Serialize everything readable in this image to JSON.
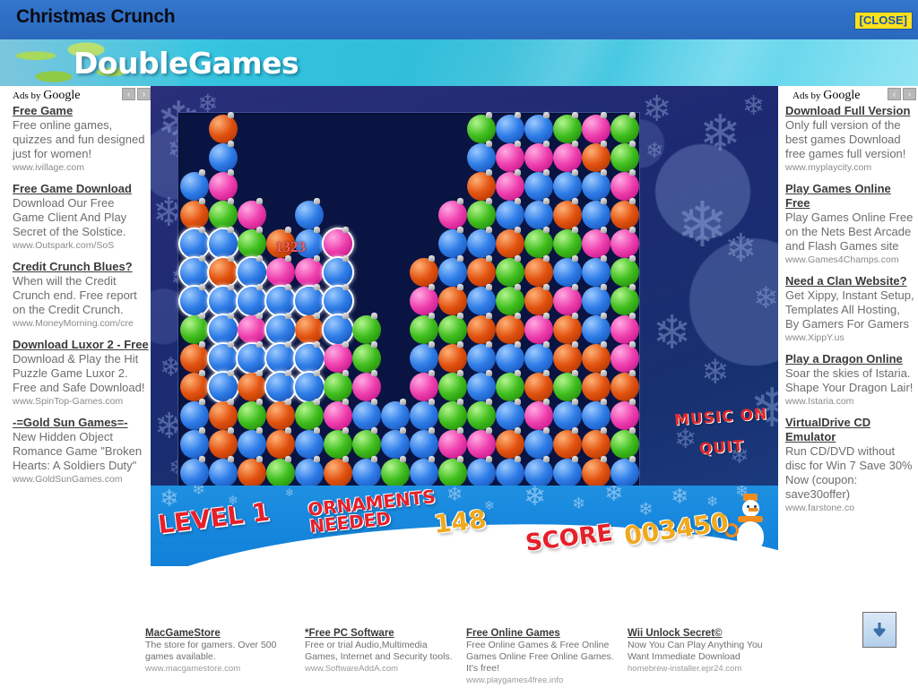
{
  "window": {
    "title": "Christmas Crunch",
    "close_label": "[CLOSE]"
  },
  "banner": {
    "logo": "DoubleGames"
  },
  "ads_left": {
    "header": "Ads by ",
    "brand": "Google",
    "prev": "‹",
    "next": "›",
    "items": [
      {
        "title": "Free Game",
        "desc": "Free online games, quizzes and fun designed just for women!",
        "url": "www.ivillage.com"
      },
      {
        "title": "Free Game Download",
        "desc": "Download Our Free Game Client And Play Secret of the Solstice.",
        "url": "www.Outspark.com/SoS"
      },
      {
        "title": "Credit Crunch Blues?",
        "desc": "When will the Credit Crunch end. Free report on the Credit Crunch.",
        "url": "www.MoneyMorning.com/cre"
      },
      {
        "title": "Download Luxor 2 - Free",
        "desc": "Download & Play the Hit Puzzle Game Luxor 2. Free and Safe Download!",
        "url": "www.SpinTop-Games.com"
      },
      {
        "title": "-=Gold Sun Games=-",
        "desc": "New Hidden Object Romance Game \"Broken Hearts: A Soldiers Duty\"",
        "url": "www.GoldSunGames.com"
      }
    ]
  },
  "ads_right": {
    "header": "Ads by ",
    "brand": "Google",
    "prev": "‹",
    "next": "›",
    "items": [
      {
        "title": "Download Full Version",
        "desc": "Only full version of the best games Download free games full version!",
        "url": "www.myplaycity.com"
      },
      {
        "title": "Play Games Online Free",
        "desc": "Play Games Online Free on the Nets Best Arcade and Flash Games site",
        "url": "www.Games4Champs.com"
      },
      {
        "title": "Need a Clan Website?",
        "desc": "Get Xippy, Instant Setup, Templates All Hosting, By Gamers For Gamers",
        "url": "www.XippY.us"
      },
      {
        "title": "Play a Dragon Online",
        "desc": "Soar the skies of Istaria. Shape Your Dragon Lair!",
        "url": "www.Istaria.com"
      },
      {
        "title": "VirtualDrive CD Emulator",
        "desc": "Run CD/DVD without disc for Win 7 Save 30% Now (coupon: save30offer)",
        "url": "www.farstone.co"
      }
    ]
  },
  "ads_footer": [
    {
      "title": "MacGameStore",
      "desc": "The store for gamers. Over 500 games available.",
      "url": "www.macgamestore.com"
    },
    {
      "title": "*Free PC Software",
      "desc": "Free or trial Audio,Multimedia Games, Internet and Security tools.",
      "url": "www.SoftwareAddA.com"
    },
    {
      "title": "Free Online Games",
      "desc": "Free Online Games & Free Online Games Online Free Online Games. It's free!",
      "url": "www.playgames4free.info"
    },
    {
      "title": "Wii Unlock Secret©",
      "desc": "Now You Can Play Anything You Want Immediate Download",
      "url": "homebrew-installer.epr24.com"
    }
  ],
  "game": {
    "level_label": "LEVEL 1",
    "ornaments_label": "ORNAMENTS NEEDED",
    "ornaments_value": "148",
    "score_label": "SCORE",
    "score_value": "003450",
    "popup_score": "1323",
    "music_label": "MUSIC ON",
    "quit_label": "QUIT",
    "colors": {
      "blue": "#2f7de8",
      "orange": "#e2520f",
      "green": "#3fbe1e",
      "pink": "#ef3fae",
      "board_bg": "#0a1442",
      "stage_bg": "#1d2a72",
      "snow_blue": "#1687dd"
    },
    "grid": {
      "cols": 16,
      "rows": 13,
      "cell": 32,
      "legend": {
        "b": "blue",
        "o": "orange",
        "g": "green",
        "p": "pink",
        ".": "empty"
      },
      "cells": [
        ". o . . . . . . . . g b b g p g",
        ". b . . . . . . . . b p p p o g",
        "b p . . . . . . . . o p b b b p",
        "o g p . b . . . . p g b b o b o",
        "b b g o b p . . . b b o g g p p",
        "b o b p p b . . o b o g o b b g",
        "b b b b b b . . p o b g o p b g",
        "g b p b o b g . g g o o p o b p",
        "o b b b b p g . b o b b b o o p",
        "o b o b b g p . p g b g o g o o",
        "b o g o g p b b b g g b p b b p",
        "b o b o b g g b b p p o b o o g",
        "b b o g b o b g b g b b b b o b"
      ],
      "selected": [
        [
          4,
          0
        ],
        [
          4,
          1
        ],
        [
          5,
          0
        ],
        [
          5,
          2
        ],
        [
          6,
          0
        ],
        [
          6,
          1
        ],
        [
          6,
          2
        ],
        [
          6,
          3
        ],
        [
          6,
          4
        ],
        [
          6,
          5
        ],
        [
          5,
          5
        ],
        [
          4,
          5
        ],
        [
          7,
          1
        ],
        [
          7,
          3
        ],
        [
          7,
          5
        ],
        [
          8,
          1
        ],
        [
          8,
          2
        ],
        [
          8,
          3
        ],
        [
          8,
          4
        ],
        [
          9,
          1
        ],
        [
          9,
          3
        ],
        [
          9,
          4
        ],
        [
          5,
          1
        ]
      ]
    }
  }
}
